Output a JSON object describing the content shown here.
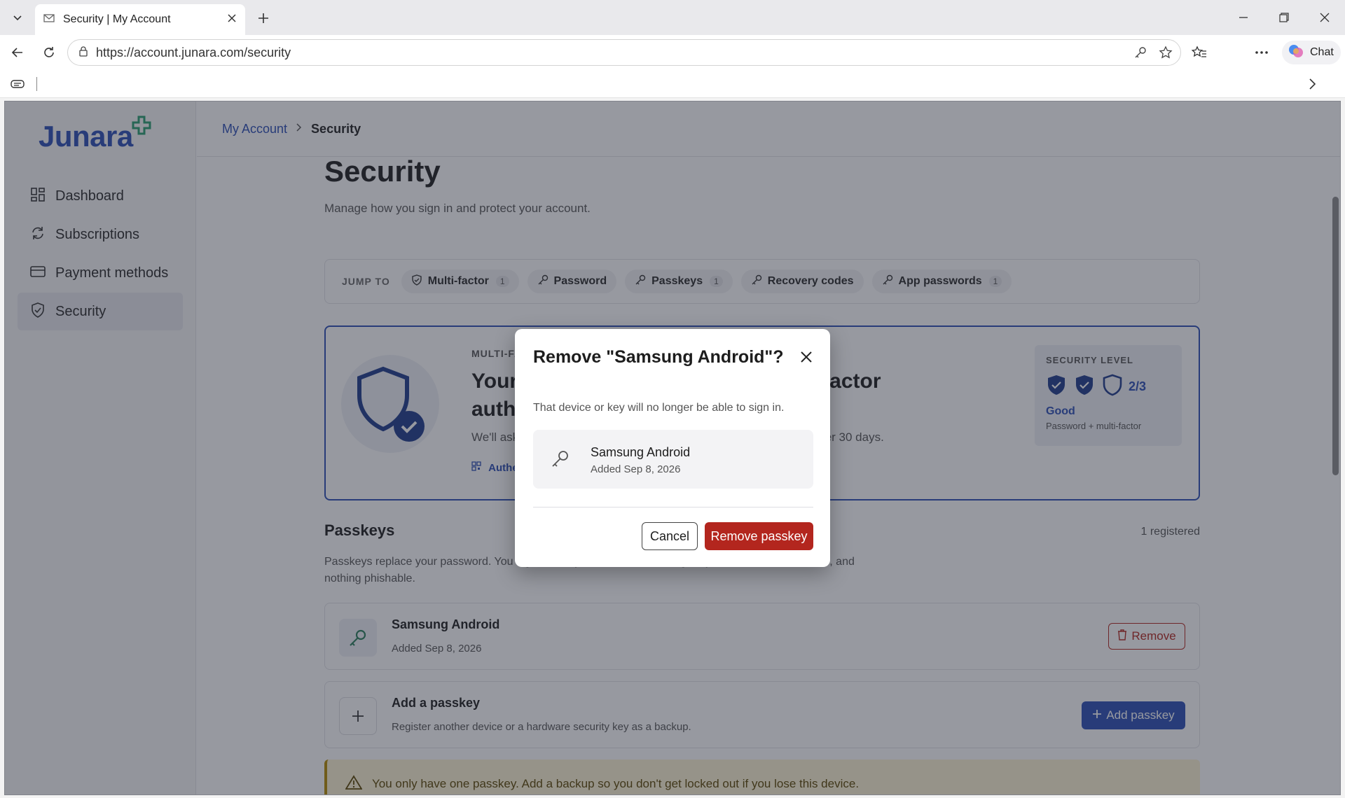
{
  "browser": {
    "tab_title": "Security | My Account",
    "url": "https://account.junara.com/security",
    "chat_label": "Chat"
  },
  "sidebar": {
    "logo": "Junara",
    "items": [
      {
        "label": "Dashboard",
        "icon": "dashboard-icon"
      },
      {
        "label": "Subscriptions",
        "icon": "refresh-icon"
      },
      {
        "label": "Payment methods",
        "icon": "card-icon"
      },
      {
        "label": "Security",
        "icon": "shield-icon",
        "active": true
      }
    ]
  },
  "breadcrumb": {
    "parent": "My Account",
    "current": "Security"
  },
  "page": {
    "title": "Security",
    "subtitle": "Manage how you sign in and protect your account."
  },
  "jump": {
    "label": "JUMP TO",
    "chips": [
      {
        "label": "Multi-factor",
        "count": "1"
      },
      {
        "label": "Password",
        "count": ""
      },
      {
        "label": "Passkeys",
        "count": "1"
      },
      {
        "label": "Recovery codes",
        "count": ""
      },
      {
        "label": "App passwords",
        "count": "1"
      }
    ]
  },
  "mfa": {
    "eyebrow": "MULTI-FACTOR",
    "title": "Your account is protected by multi-factor authentication",
    "desc": "We'll ask for a second step when you sign in on a new device or after 30 days.",
    "tag": "Authenticator app"
  },
  "security_level": {
    "eyebrow": "SECURITY LEVEL",
    "score": "2/3",
    "filled": 2,
    "total": 3,
    "name": "Good",
    "desc": "Password + multi-factor"
  },
  "passkeys": {
    "title": "Passkeys",
    "count": "1 registered",
    "desc": "Passkeys replace your password. You sign in with your device — nothing for you to have to remember, and nothing phishable.",
    "items": [
      {
        "name": "Samsung Android",
        "added": "Added Sep 8, 2026",
        "remove_label": "Remove"
      }
    ],
    "add": {
      "title": "Add a passkey",
      "desc": "Register another device or a hardware security key as a backup.",
      "button": "Add passkey"
    },
    "warning": "You only have one passkey. Add a backup so you don't get locked out if you lose this device."
  },
  "modal": {
    "title": "Remove \"Samsung Android\"?",
    "desc": "That device or key will no longer be able to sign in.",
    "device_name": "Samsung Android",
    "device_added": "Added Sep 8, 2026",
    "cancel": "Cancel",
    "confirm": "Remove passkey"
  },
  "colors": {
    "brand": "#2b4eb5",
    "danger": "#b3261e",
    "warning_bg": "#fdf3d4"
  }
}
